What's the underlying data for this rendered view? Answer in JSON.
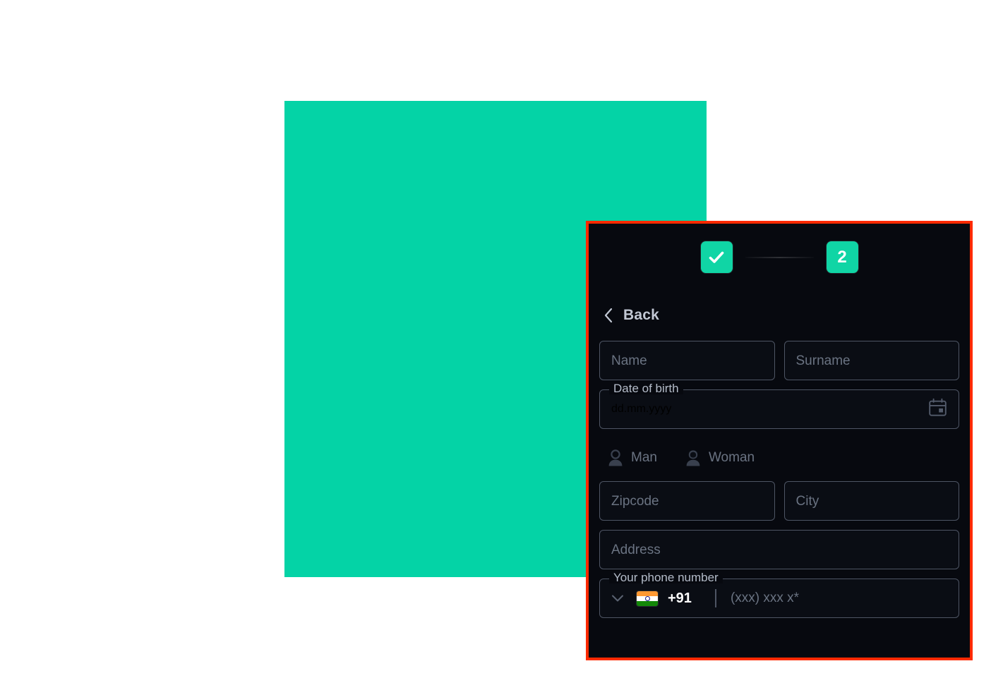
{
  "theme": {
    "frame_color": "#04d3a6",
    "highlight_border_color": "#ff2a00",
    "panel_background": "#07090f",
    "accent_color": "#10d5a5",
    "field_border_color": "#4e5564",
    "placeholder_color": "#6a7382"
  },
  "stepper": {
    "step1": {
      "state": "completed",
      "icon": "check-icon"
    },
    "step2": {
      "label": "2",
      "state": "active"
    }
  },
  "back": {
    "label": "Back",
    "icon": "chevron-left-icon"
  },
  "form": {
    "name": {
      "placeholder": "Name",
      "value": ""
    },
    "surname": {
      "placeholder": "Surname",
      "value": ""
    },
    "date_of_birth": {
      "legend": "Date of birth",
      "placeholder": "dd.mm.yyyy",
      "value": "",
      "icon": "calendar-icon"
    },
    "gender": {
      "options": [
        {
          "label": "Man",
          "icon": "man-icon",
          "selected": false
        },
        {
          "label": "Woman",
          "icon": "woman-icon",
          "selected": false
        }
      ]
    },
    "zipcode": {
      "placeholder": "Zipcode",
      "value": ""
    },
    "city": {
      "placeholder": "City",
      "value": ""
    },
    "address": {
      "placeholder": "Address",
      "value": ""
    },
    "phone": {
      "legend": "Your phone number",
      "country_flag": "india-flag-icon",
      "dial_code": "+91",
      "placeholder": "(xxx) xxx x*",
      "value": "",
      "dropdown_icon": "chevron-down-icon"
    }
  }
}
